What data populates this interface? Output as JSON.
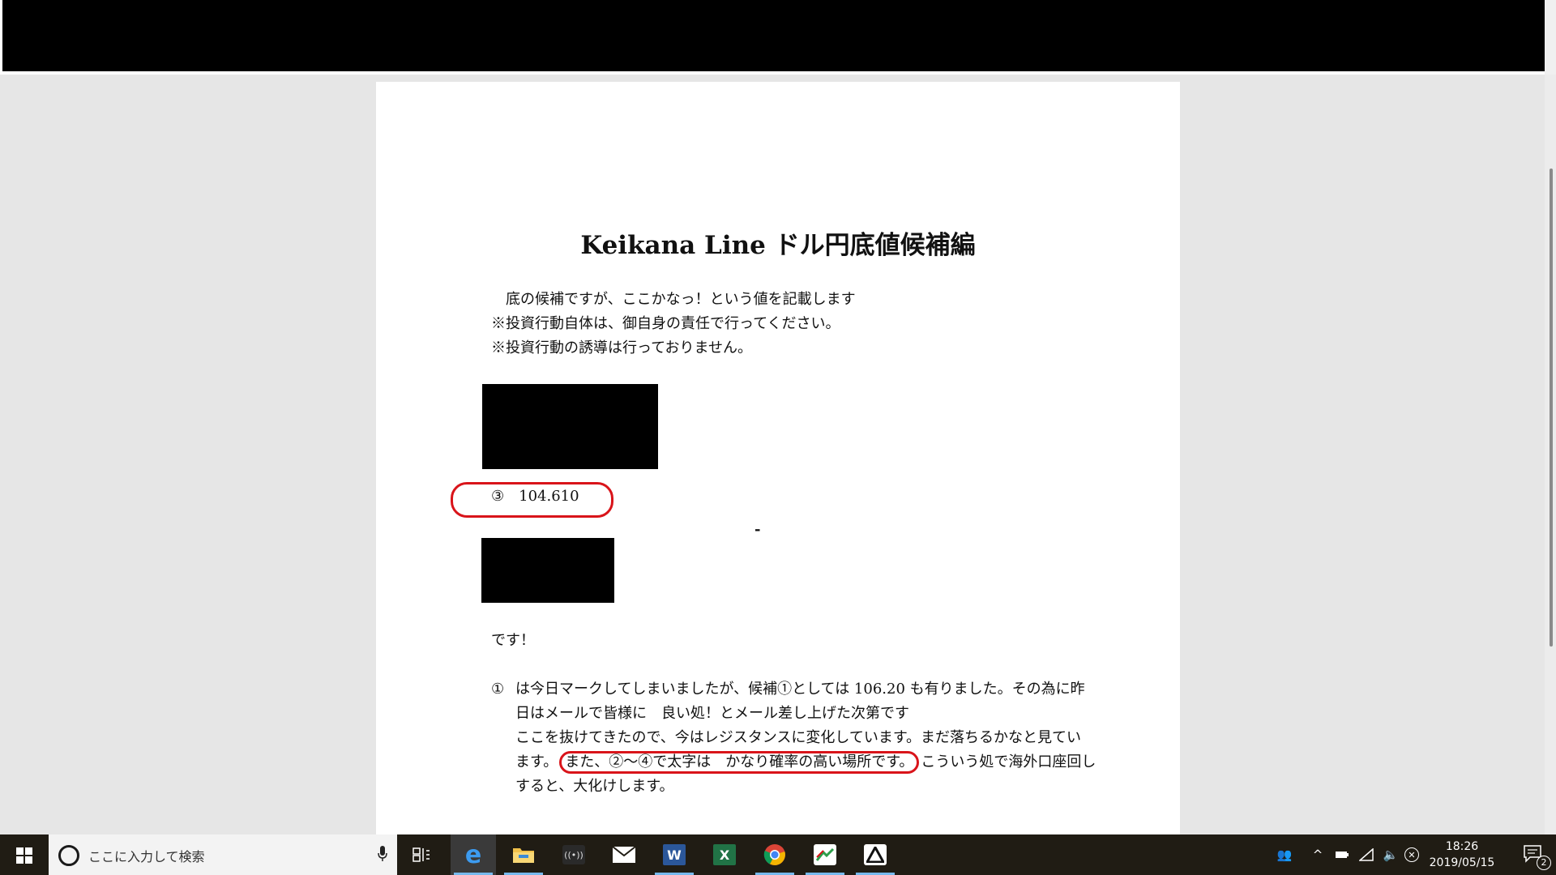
{
  "document": {
    "title": "Keikana Line  ドル円底値候補編",
    "intro_lines": [
      "　底の候補ですが、ここかなっ！という値を記載します",
      "※投資行動自体は、御自身の責任で行ってください。",
      "※投資行動の誘導は行っておりません。"
    ],
    "candidate_3": "③　104.610",
    "minus_mark": "-",
    "desu": "です！",
    "note_marker": "①",
    "note_lines": [
      "は今日マークしてしまいましたが、候補①としては 106.20 も有りました。その為に昨",
      "日はメールで皆様に　良い処！とメール差し上げた次第です",
      "ここを抜けてきたので、今はレジスタンスに変化しています。まだ落ちるかなと見てい"
    ],
    "note_line4_pre": "ます。",
    "note_line4_highlight": "また、②～④で太字は　かなり確率の高い場所です。",
    "note_line4_post": "こういう処で海外口座回し",
    "note_line5": "すると、大化けします。",
    "annotation_color": "#d9141a"
  },
  "taskbar": {
    "search_placeholder": "ここに入力して検索",
    "time": "18:26",
    "date": "2019/05/15",
    "notification_count": "2",
    "apps": [
      {
        "icon": "task-view-icon"
      },
      {
        "icon": "edge-icon"
      },
      {
        "icon": "file-explorer-icon"
      },
      {
        "icon": "broadcast-app-icon"
      },
      {
        "icon": "mail-icon"
      },
      {
        "icon": "word-icon",
        "label": "W",
        "color": "#2b579a"
      },
      {
        "icon": "excel-icon",
        "label": "X",
        "color": "#217346"
      },
      {
        "icon": "chrome-icon"
      },
      {
        "icon": "trading-app-icon"
      },
      {
        "icon": "mt4-icon"
      }
    ]
  }
}
